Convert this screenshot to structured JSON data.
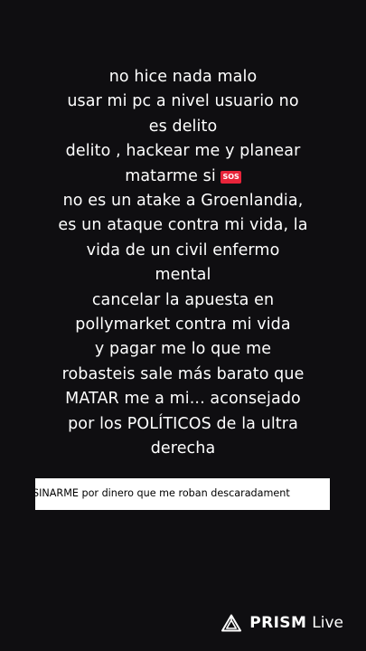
{
  "message": {
    "lines": [
      "no hice nada malo",
      "usar mi pc a nivel usuario no",
      "es delito",
      "delito , hackear me y planear",
      "matarme si",
      "no es un atake a Groenlandia,",
      "es un ataque contra mi vida, la",
      "vida de un civil enfermo",
      "mental",
      "cancelar la apuesta en",
      "pollymarket contra mi vida",
      "y pagar me lo que me",
      "robasteis sale más barato que",
      "MATAR me a mi... aconsejado",
      "por los POLÍTICOS de la ultra",
      "derecha"
    ],
    "sos_badge": "SOS",
    "sos_color": "#e8243a"
  },
  "caption": {
    "text": "SINARME por dinero que me roban descaradament"
  },
  "watermark": {
    "brand": "PRISM",
    "suffix": "Live",
    "icon": "prism-triangle-icon"
  }
}
